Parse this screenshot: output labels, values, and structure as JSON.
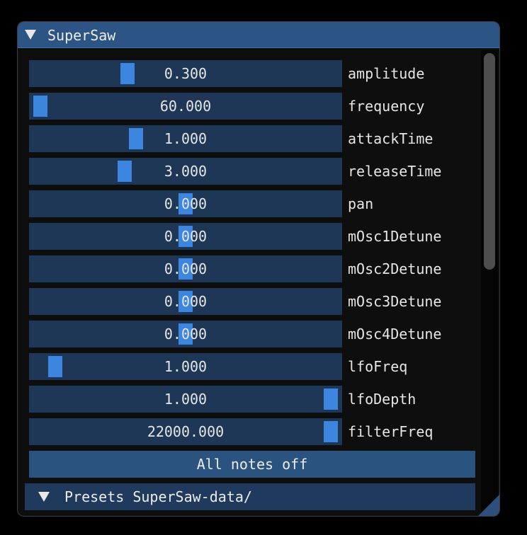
{
  "window": {
    "title": "SuperSaw"
  },
  "params": [
    {
      "label": "amplitude",
      "value": "0.300",
      "level": 0.3
    },
    {
      "label": "frequency",
      "value": "60.000",
      "level": 0.0
    },
    {
      "label": "attackTime",
      "value": "1.000",
      "level": 0.33
    },
    {
      "label": "releaseTime",
      "value": "3.000",
      "level": 0.29
    },
    {
      "label": "pan",
      "value": "0.000",
      "level": 0.5
    },
    {
      "label": "mOsc1Detune",
      "value": "0.000",
      "level": 0.5
    },
    {
      "label": "mOsc2Detune",
      "value": "0.000",
      "level": 0.5
    },
    {
      "label": "mOsc3Detune",
      "value": "0.000",
      "level": 0.5
    },
    {
      "label": "mOsc4Detune",
      "value": "0.000",
      "level": 0.5
    },
    {
      "label": "lfoFreq",
      "value": "1.000",
      "level": 0.05
    },
    {
      "label": "lfoDepth",
      "value": "1.000",
      "level": 1.0
    },
    {
      "label": "filterFreq",
      "value": "22000.000",
      "level": 1.0
    }
  ],
  "buttons": {
    "all_notes_off": "All notes off"
  },
  "presets": {
    "header": "Presets SuperSaw-data/"
  },
  "colors": {
    "title_bar": "#2c5485",
    "slider_frame": "#1e3756",
    "slider_grab": "#3d86e0",
    "button": "#2b5380",
    "header": "#1f3a5c"
  },
  "icons": {
    "title_collapse": "triangle-down-icon",
    "presets_collapse": "triangle-down-icon"
  }
}
